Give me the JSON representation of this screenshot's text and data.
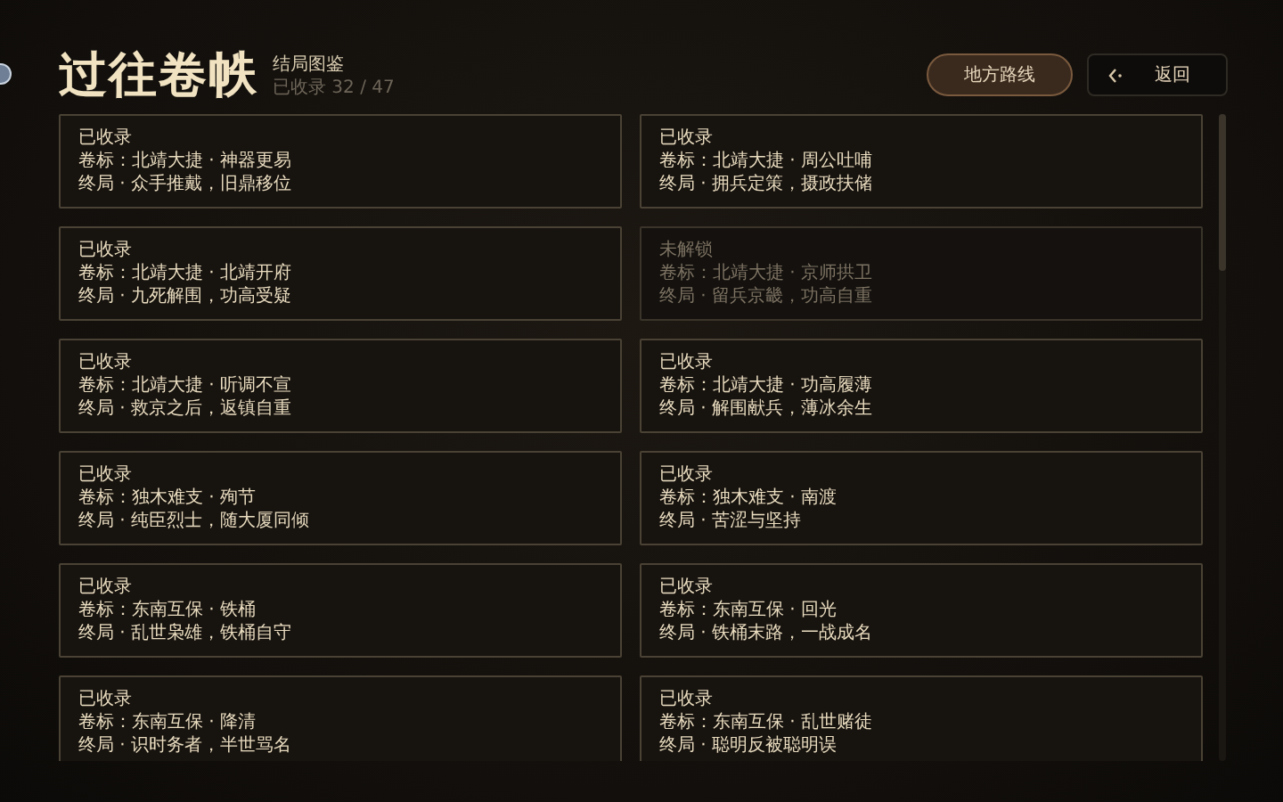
{
  "header": {
    "title": "过往卷帙",
    "subtitle": "结局图鉴",
    "progress": "已收录 32 / 47"
  },
  "buttons": [
    {
      "label": "地方路线",
      "kind": "primary"
    },
    {
      "label": "返回",
      "kind": "back"
    }
  ],
  "endings": [
    {
      "status": "已收录",
      "volume": "卷标：北靖大捷 · 神器更易",
      "ending": "终局 · 众手推戴，旧鼎移位",
      "unlocked": true
    },
    {
      "status": "已收录",
      "volume": "卷标：北靖大捷 · 周公吐哺",
      "ending": "终局 · 拥兵定策，摄政扶储",
      "unlocked": true
    },
    {
      "status": "已收录",
      "volume": "卷标：北靖大捷 · 北靖开府",
      "ending": "终局 · 九死解围，功高受疑",
      "unlocked": true
    },
    {
      "status": "未解锁",
      "volume": "卷标：北靖大捷 · 京师拱卫",
      "ending": "终局 · 留兵京畿，功高自重",
      "unlocked": false
    },
    {
      "status": "已收录",
      "volume": "卷标：北靖大捷 · 听调不宣",
      "ending": "终局 · 救京之后，返镇自重",
      "unlocked": true
    },
    {
      "status": "已收录",
      "volume": "卷标：北靖大捷 · 功高履薄",
      "ending": "终局 · 解围献兵，薄冰余生",
      "unlocked": true
    },
    {
      "status": "已收录",
      "volume": "卷标：独木难支 · 殉节",
      "ending": "终局 · 纯臣烈士，随大厦同倾",
      "unlocked": true
    },
    {
      "status": "已收录",
      "volume": "卷标：独木难支 · 南渡",
      "ending": "终局 · 苦涩与坚持",
      "unlocked": true
    },
    {
      "status": "已收录",
      "volume": "卷标：东南互保 · 铁桶",
      "ending": "终局 · 乱世枭雄，铁桶自守",
      "unlocked": true
    },
    {
      "status": "已收录",
      "volume": "卷标：东南互保 · 回光",
      "ending": "终局 · 铁桶末路，一战成名",
      "unlocked": true
    },
    {
      "status": "已收录",
      "volume": "卷标：东南互保 · 降清",
      "ending": "终局 · 识时务者，半世骂名",
      "unlocked": true
    },
    {
      "status": "已收录",
      "volume": "卷标：东南互保 · 乱世赌徒",
      "ending": "终局 · 聪明反被聪明误",
      "unlocked": true
    }
  ]
}
